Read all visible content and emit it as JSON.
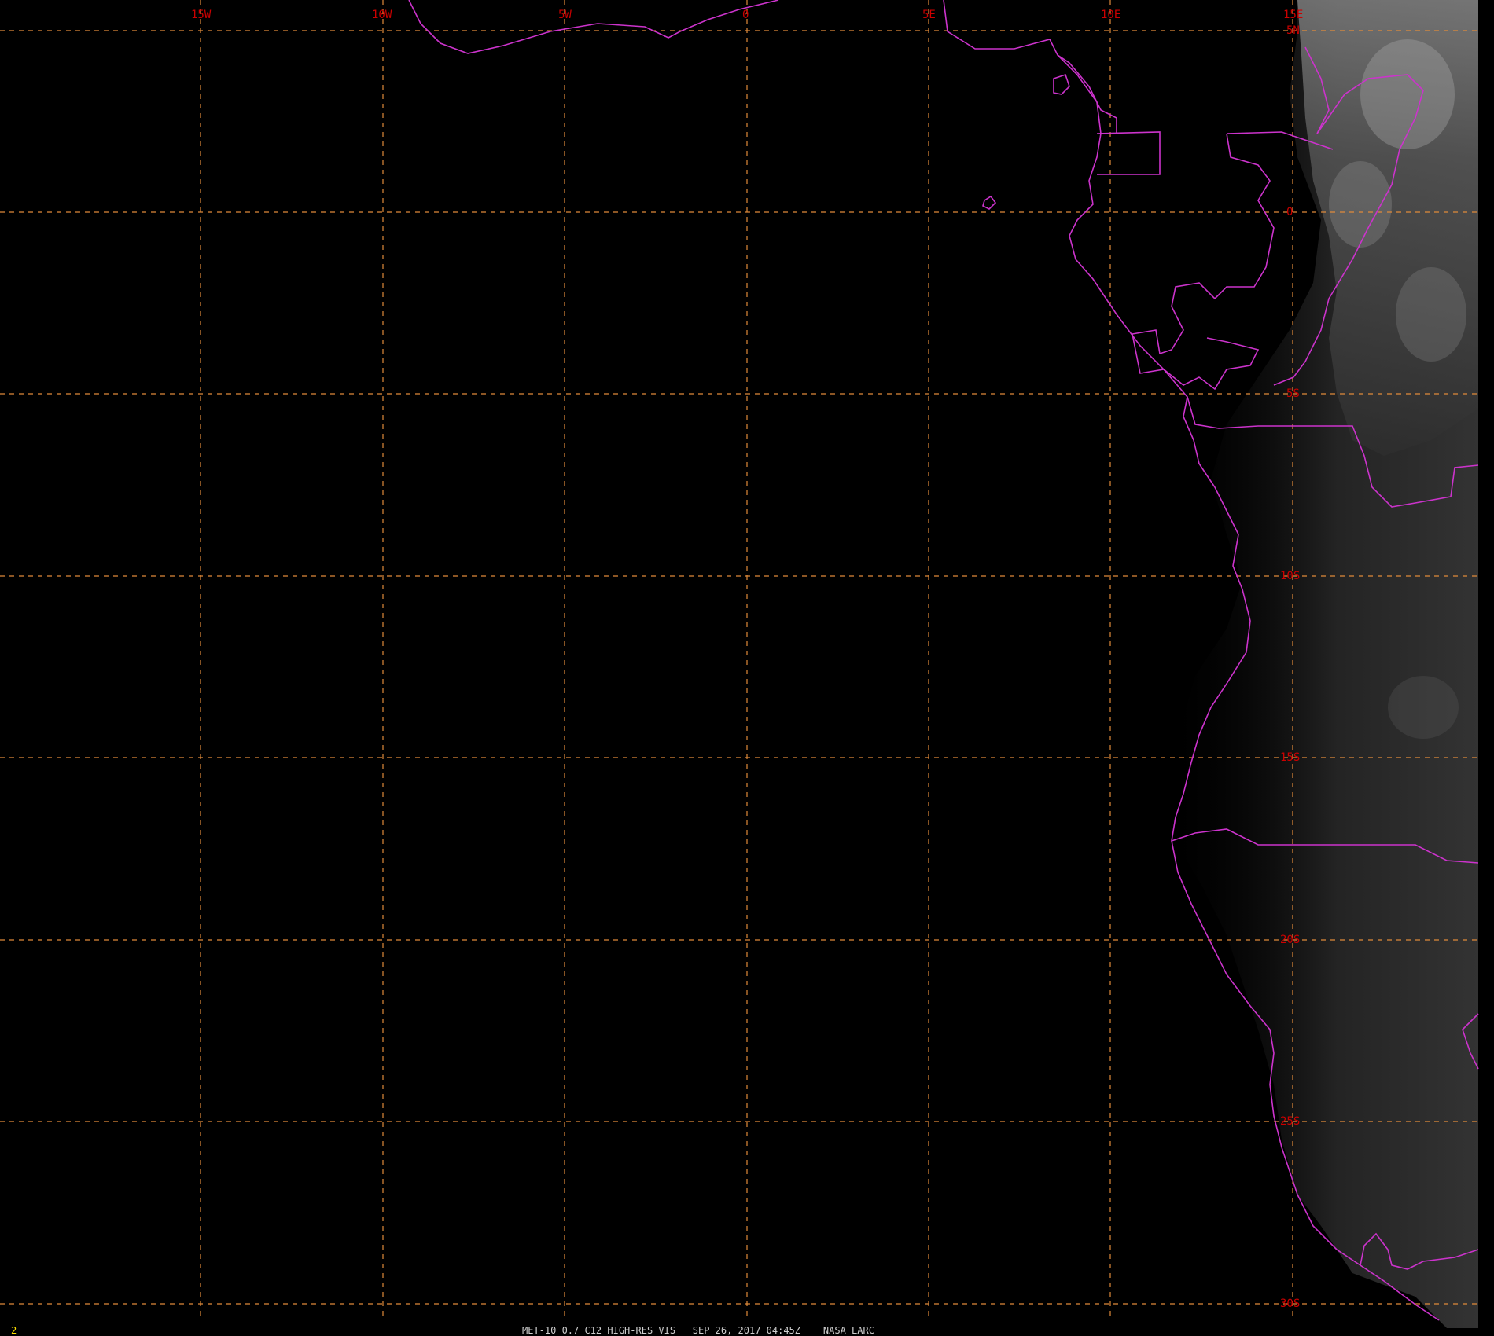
{
  "map": {
    "lon_labels": [
      "15W",
      "10W",
      "5W",
      "0",
      "5E",
      "10E",
      "15E"
    ],
    "lat_labels": [
      "5N",
      "0",
      "5S",
      "10S",
      "15S",
      "20S",
      "25S",
      "30S"
    ]
  },
  "footer": {
    "frame_number": "2",
    "caption": "MET-10 0.7 C12 HIGH-RES VIS   SEP 26, 2017 04:45Z    NASA LARC"
  },
  "colors": {
    "background": "#000000",
    "grid": "#e08a3a",
    "labels": "#cc0000",
    "borders": "#cc33cc",
    "frame_number": "#ffe000",
    "caption": "#cfcfcf"
  }
}
